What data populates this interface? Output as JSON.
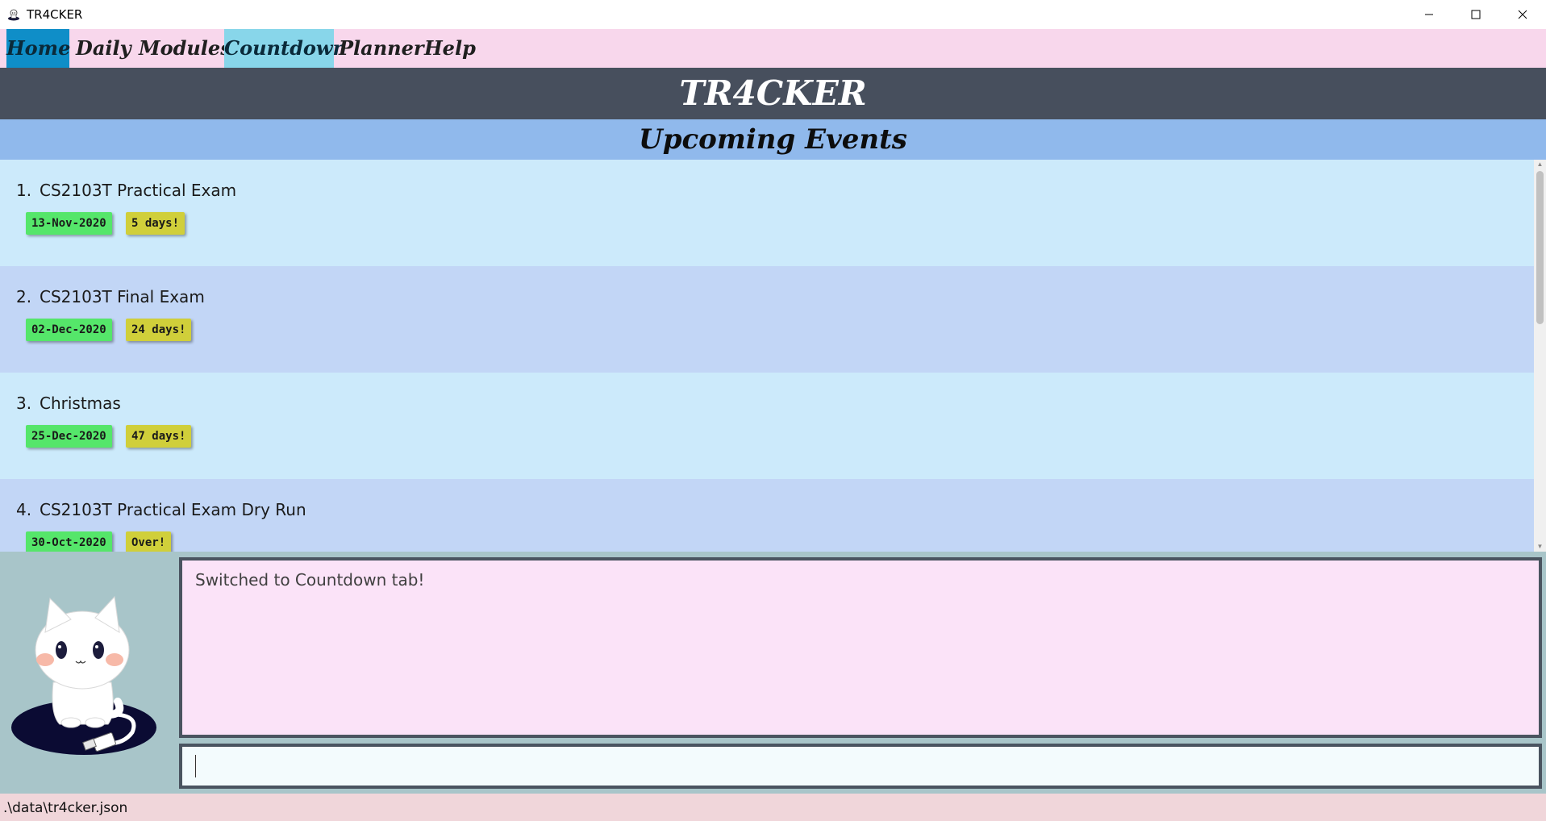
{
  "window": {
    "title": "TR4CKER",
    "minimize_label": "—",
    "maximize_label": "☐",
    "close_label": "✕"
  },
  "menu": {
    "items": [
      {
        "label": "Home"
      },
      {
        "label": "Daily"
      },
      {
        "label": "Modules"
      },
      {
        "label": "Countdown"
      },
      {
        "label": "Planner"
      },
      {
        "label": "Help"
      }
    ],
    "active": "Countdown"
  },
  "header": {
    "app_name": "TR4CKER",
    "section_title": "Upcoming Events"
  },
  "events": [
    {
      "index": "1.",
      "title": "CS2103T Practical Exam",
      "date": "13-Nov-2020",
      "countdown": "5 days!"
    },
    {
      "index": "2.",
      "title": "CS2103T Final Exam",
      "date": "02-Dec-2020",
      "countdown": "24 days!"
    },
    {
      "index": "3.",
      "title": "Christmas",
      "date": "25-Dec-2020",
      "countdown": "47 days!"
    },
    {
      "index": "4.",
      "title": "CS2103T Practical Exam Dry Run",
      "date": "30-Oct-2020",
      "countdown": "Over!"
    }
  ],
  "result_display": {
    "text": "Switched to Countdown tab!"
  },
  "command_box": {
    "value": ""
  },
  "status_bar": {
    "file_path": ".\\data\\tr4cker.json"
  },
  "colors": {
    "menu_bg": "#f8d7ec",
    "home_tab": "#0f8ec8",
    "active_tab": "#88d6ea",
    "header_bg": "#474f5d",
    "section_bg": "#90b9ec",
    "date_tag": "#55e66a",
    "countdown_tag": "#d0cf3a",
    "result_bg": "#fbe3f8",
    "bottom_bg": "#a8c5c9"
  }
}
